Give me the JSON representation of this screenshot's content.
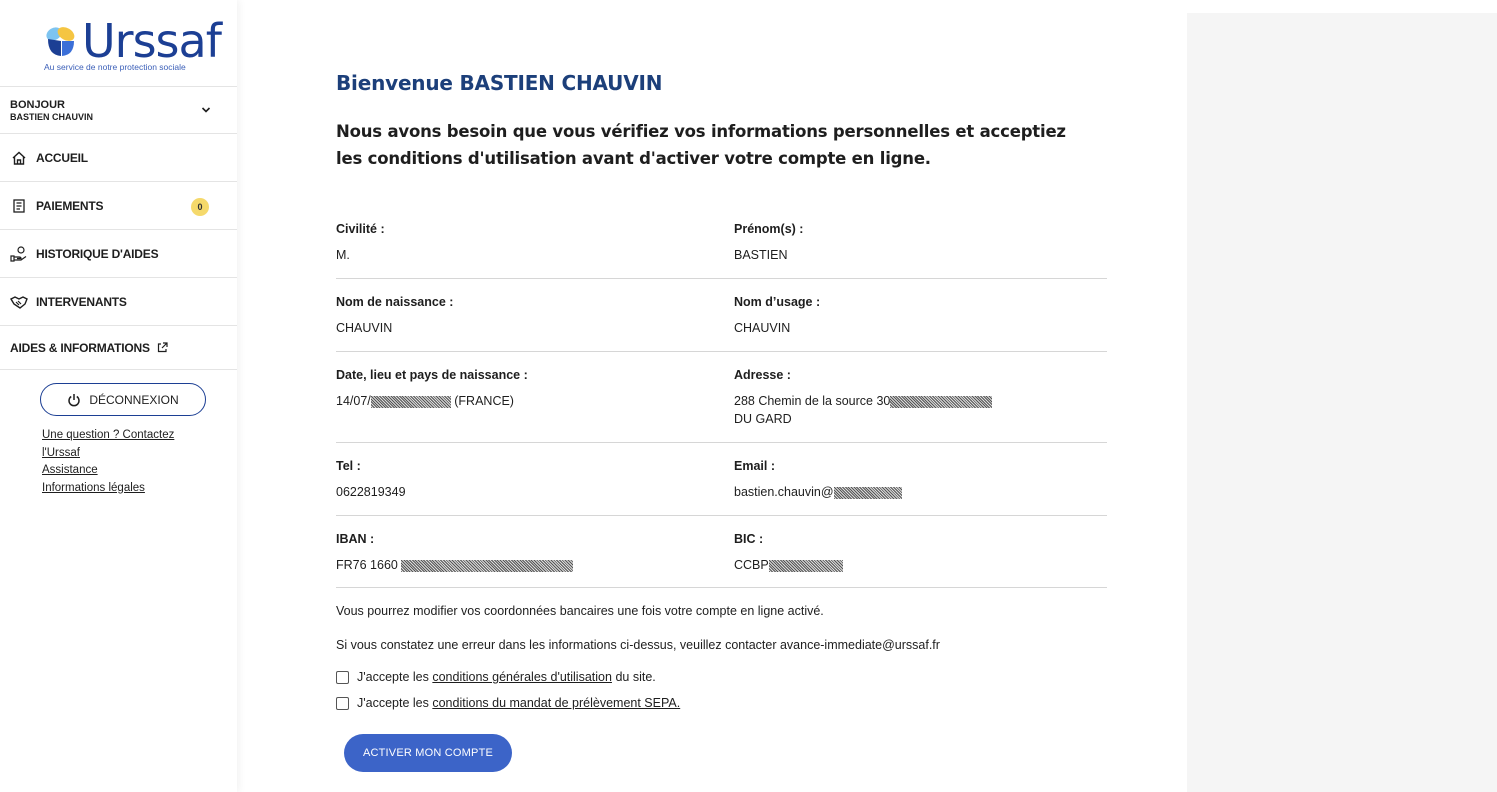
{
  "logo": {
    "name": "Urssaf",
    "tagline": "Au service de notre protection sociale"
  },
  "user_menu": {
    "greeting": "BONJOUR",
    "name": "BASTIEN CHAUVIN"
  },
  "nav": {
    "items": [
      {
        "label": "ACCUEIL",
        "icon": "home-icon"
      },
      {
        "label": "PAIEMENTS",
        "icon": "document-icon",
        "badge": "0"
      },
      {
        "label": "HISTORIQUE D'AIDES",
        "icon": "hand-coin-icon"
      },
      {
        "label": "INTERVENANTS",
        "icon": "handshake-icon"
      },
      {
        "label": "AIDES & INFORMATIONS",
        "icon": "external-link-icon"
      }
    ]
  },
  "logout_label": "DÉCONNEXION",
  "side_links": [
    "Une question ? Contactez l'Urssaf",
    "Assistance",
    "Informations légales"
  ],
  "page": {
    "title": "Bienvenue BASTIEN CHAUVIN",
    "subtitle": "Nous avons besoin que vous vérifiez vos informations personnelles et acceptiez les conditions d'utilisation avant d'activer votre compte en ligne."
  },
  "fields": {
    "civilite": {
      "label": "Civilité :",
      "value": "M."
    },
    "prenom": {
      "label": "Prénom(s) :",
      "value": "BASTIEN"
    },
    "nom_naissance": {
      "label": "Nom de naissance :",
      "value": "CHAUVIN"
    },
    "nom_usage": {
      "label": "Nom d’usage :",
      "value": "CHAUVIN"
    },
    "naissance": {
      "label": "Date, lieu et pays de naissance :",
      "value_prefix": "14/07/",
      "value_suffix": "(FRANCE)"
    },
    "adresse": {
      "label": "Adresse :",
      "value_line1": "288 Chemin de la source 30",
      "value_line2": "DU GARD"
    },
    "tel": {
      "label": "Tel :",
      "value": "0622819349"
    },
    "email": {
      "label": "Email :",
      "value_prefix": "bastien.chauvin@"
    },
    "iban": {
      "label": "IBAN :",
      "value_prefix": "FR76 1660"
    },
    "bic": {
      "label": "BIC :",
      "value_prefix": "CCBP"
    }
  },
  "notes": {
    "bank_note": "Vous pourrez modifier vos coordonnées bancaires une fois votre compte en ligne activé.",
    "error_note": "Si vous constatez une erreur dans les informations ci-dessus, veuillez contacter avance-immediate@urssaf.fr"
  },
  "checkboxes": {
    "cgu": {
      "prefix": "J'accepte les",
      "link": "conditions générales d'utilisation",
      "suffix": "du site.",
      "checked": false
    },
    "sepa": {
      "prefix": "J'accepte les",
      "link": "conditions du mandat de prélèvement SEPA.",
      "checked": false
    }
  },
  "activate_label": "ACTIVER MON COMPTE",
  "colors": {
    "brand_blue": "#1c3f94",
    "button_blue": "#3c64c8",
    "badge_yellow": "#f5d96b"
  }
}
